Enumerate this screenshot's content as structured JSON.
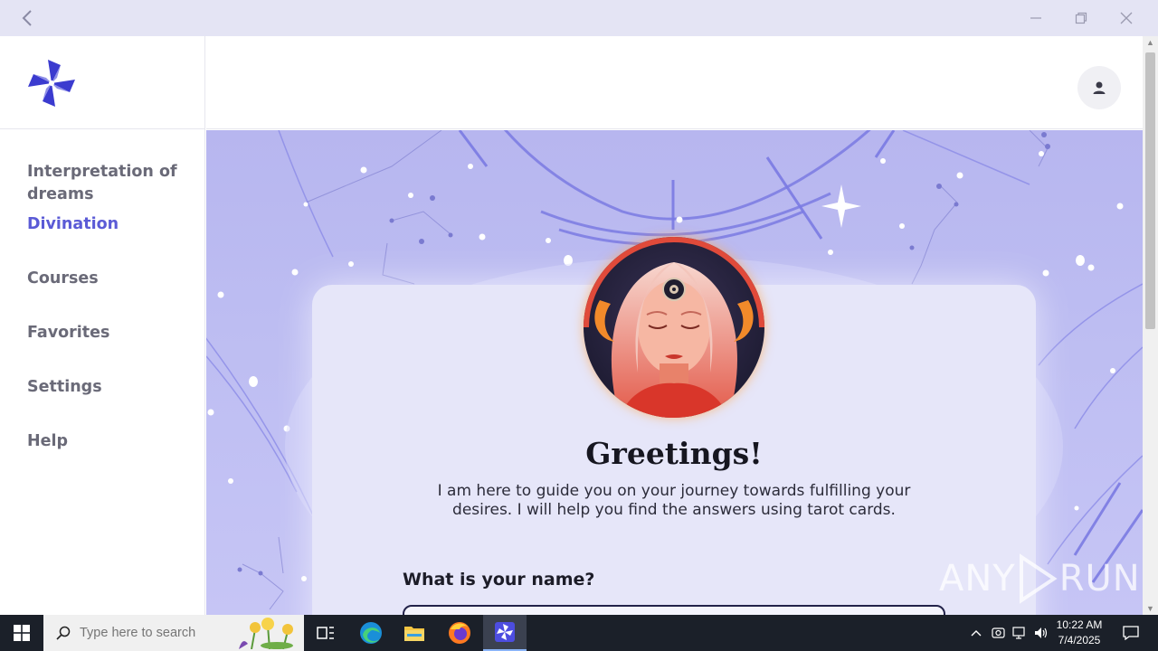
{
  "window": {
    "back_icon": "chevron-left-icon",
    "minimize_icon": "minimize-icon",
    "maximize_icon": "restore-icon",
    "close_icon": "close-icon"
  },
  "sidebar": {
    "logo": "pinwheel-logo",
    "items": [
      {
        "label": "Interpretation of dreams",
        "active": false
      },
      {
        "label": "Divination",
        "active": true
      },
      {
        "label": "Courses",
        "active": false
      },
      {
        "label": "Favorites",
        "active": false
      },
      {
        "label": "Settings",
        "active": false
      },
      {
        "label": "Help",
        "active": false
      }
    ]
  },
  "header": {
    "profile_icon": "person-icon"
  },
  "main": {
    "greeting": "Greetings!",
    "intro": "I am here to guide you on your journey towards fulfilling your desires. I will help you find the answers using tarot cards.",
    "name_label": "What is your name?",
    "name_value": "",
    "portrait": "fortune-teller-portrait"
  },
  "watermark": {
    "text_left": "ANY",
    "text_right": "RUN"
  },
  "taskbar": {
    "search_placeholder": "Type here to search",
    "apps": [
      "task-view-icon",
      "edge-icon",
      "file-explorer-icon",
      "firefox-icon",
      "tarot-app-icon"
    ],
    "clock_time": "10:22 AM",
    "clock_date": "7/4/2025"
  },
  "colors": {
    "accent": "#5b5bd6",
    "background": "#bdbdf2",
    "card": "#e6e6f9"
  }
}
